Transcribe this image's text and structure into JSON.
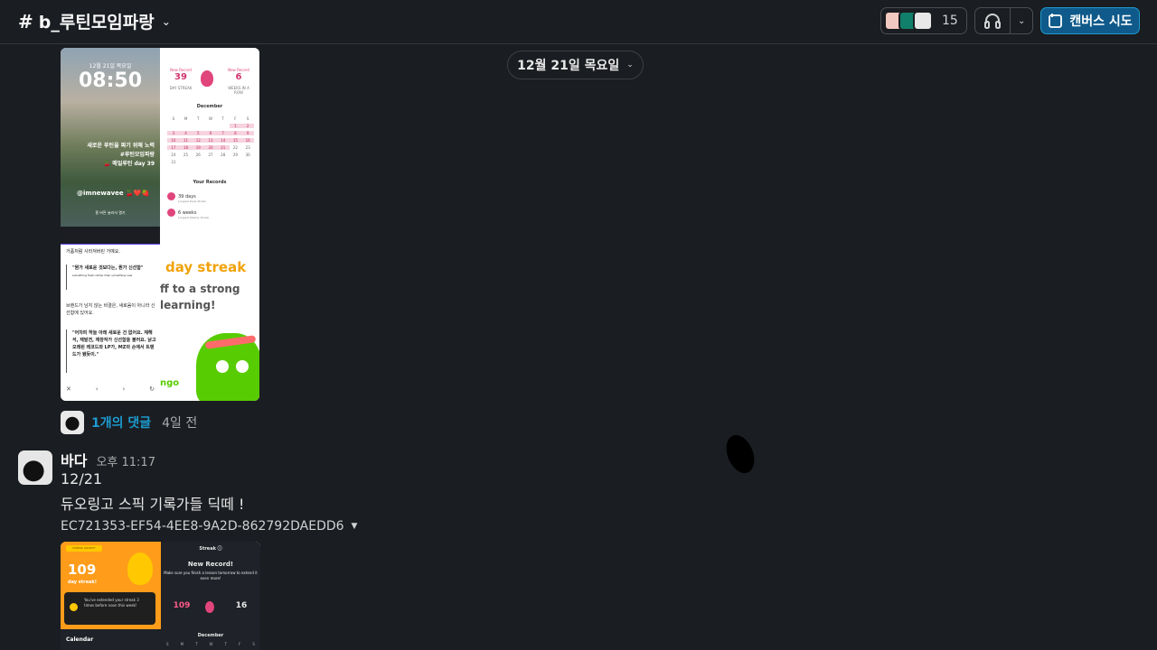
{
  "header": {
    "hash": "#",
    "channel_name": "b_루틴모임파랑",
    "member_count": "15",
    "canvas_label": "캔버스 시도"
  },
  "date_divider": {
    "label": "12월 21일 목요일"
  },
  "attachment1": {
    "lock_date": "12월 21일 목요일",
    "lock_time": "08:50",
    "lock_msg_1": "새로운 루틴을 짜기 위해 노력",
    "lock_msg_2": "#루틴모임파랑",
    "lock_msg_3": "🍒 매일루틴 day 39",
    "lock_handle": "@imnewavee 🍒❤️🍓",
    "lock_home": "홈 버튼 눌러서 열기",
    "rec1_label": "New Record",
    "rec1_value": "39",
    "rec1_unit": "DAY STREAK",
    "rec2_label": "New Record",
    "rec2_value": "6",
    "rec2_unit": "WEEKS IN A ROW",
    "calendar_month": "December",
    "your_records": "Your Records",
    "record1": "39 days",
    "record1_sub": "Longest Daily Streak",
    "record2": "6 weeks",
    "record2_sub": "Longest Weekly Streak",
    "article_p1": "거품처럼 사라져버린 거예요.",
    "article_q1": "\"뭔가 새로운 것보다는, 뭔가 신선함\"",
    "article_q1_sub": "something fresh rather than something new",
    "article_p2": "브랜드가 남지 않는 비결은, 새로움이 아니라 신선함에 있어요.",
    "article_q2": "\"어차피 하늘 아래 새로운 건 없어요. 재해석, 재발견, 재창작가 신선함을 불러요. 낡고 오래된 레코드와 LP가, MZ의 손에서 트렌드가 됐듯이.\"",
    "duo_streak": "day streak",
    "duo_line2": "ff to a strong",
    "duo_line3": "learning!",
    "duo_logo": "ngo"
  },
  "thread": {
    "reply_label": "1개의 댓글",
    "time_ago": "4일 전"
  },
  "message": {
    "sender": "바다",
    "time": "오후 11:17",
    "line1": "12/21",
    "line2": "듀오링고 스픽 기록가들 딕떼 !",
    "filename": "EC721353-EF54-4EE8-9A2D-862792DAEDD6"
  },
  "attachment2": {
    "tag": "STREAK SOCIETY",
    "streak_value": "109",
    "streak_label": "day streak!",
    "extend_msg": "You've extended your streak 3 times before noon this week!",
    "calendar": "Calendar",
    "title": "Streak ⓘ",
    "new_record": "New Record!",
    "record_msg": "Make sure you finish a lesson tomorrow to extend it even more!",
    "n1": "109",
    "n2": "16",
    "month": "December"
  },
  "calendar_days": [
    "S",
    "M",
    "T",
    "W",
    "T",
    "F",
    "S",
    "",
    "",
    "",
    "",
    "",
    "1",
    "2",
    "3",
    "4",
    "5",
    "6",
    "7",
    "8",
    "9",
    "10",
    "11",
    "12",
    "13",
    "14",
    "15",
    "16",
    "17",
    "18",
    "19",
    "20",
    "21",
    "22",
    "23",
    "24",
    "25",
    "26",
    "27",
    "28",
    "29",
    "30",
    "31"
  ],
  "weekday_short": [
    "S",
    "M",
    "T",
    "W",
    "T",
    "F",
    "S"
  ]
}
